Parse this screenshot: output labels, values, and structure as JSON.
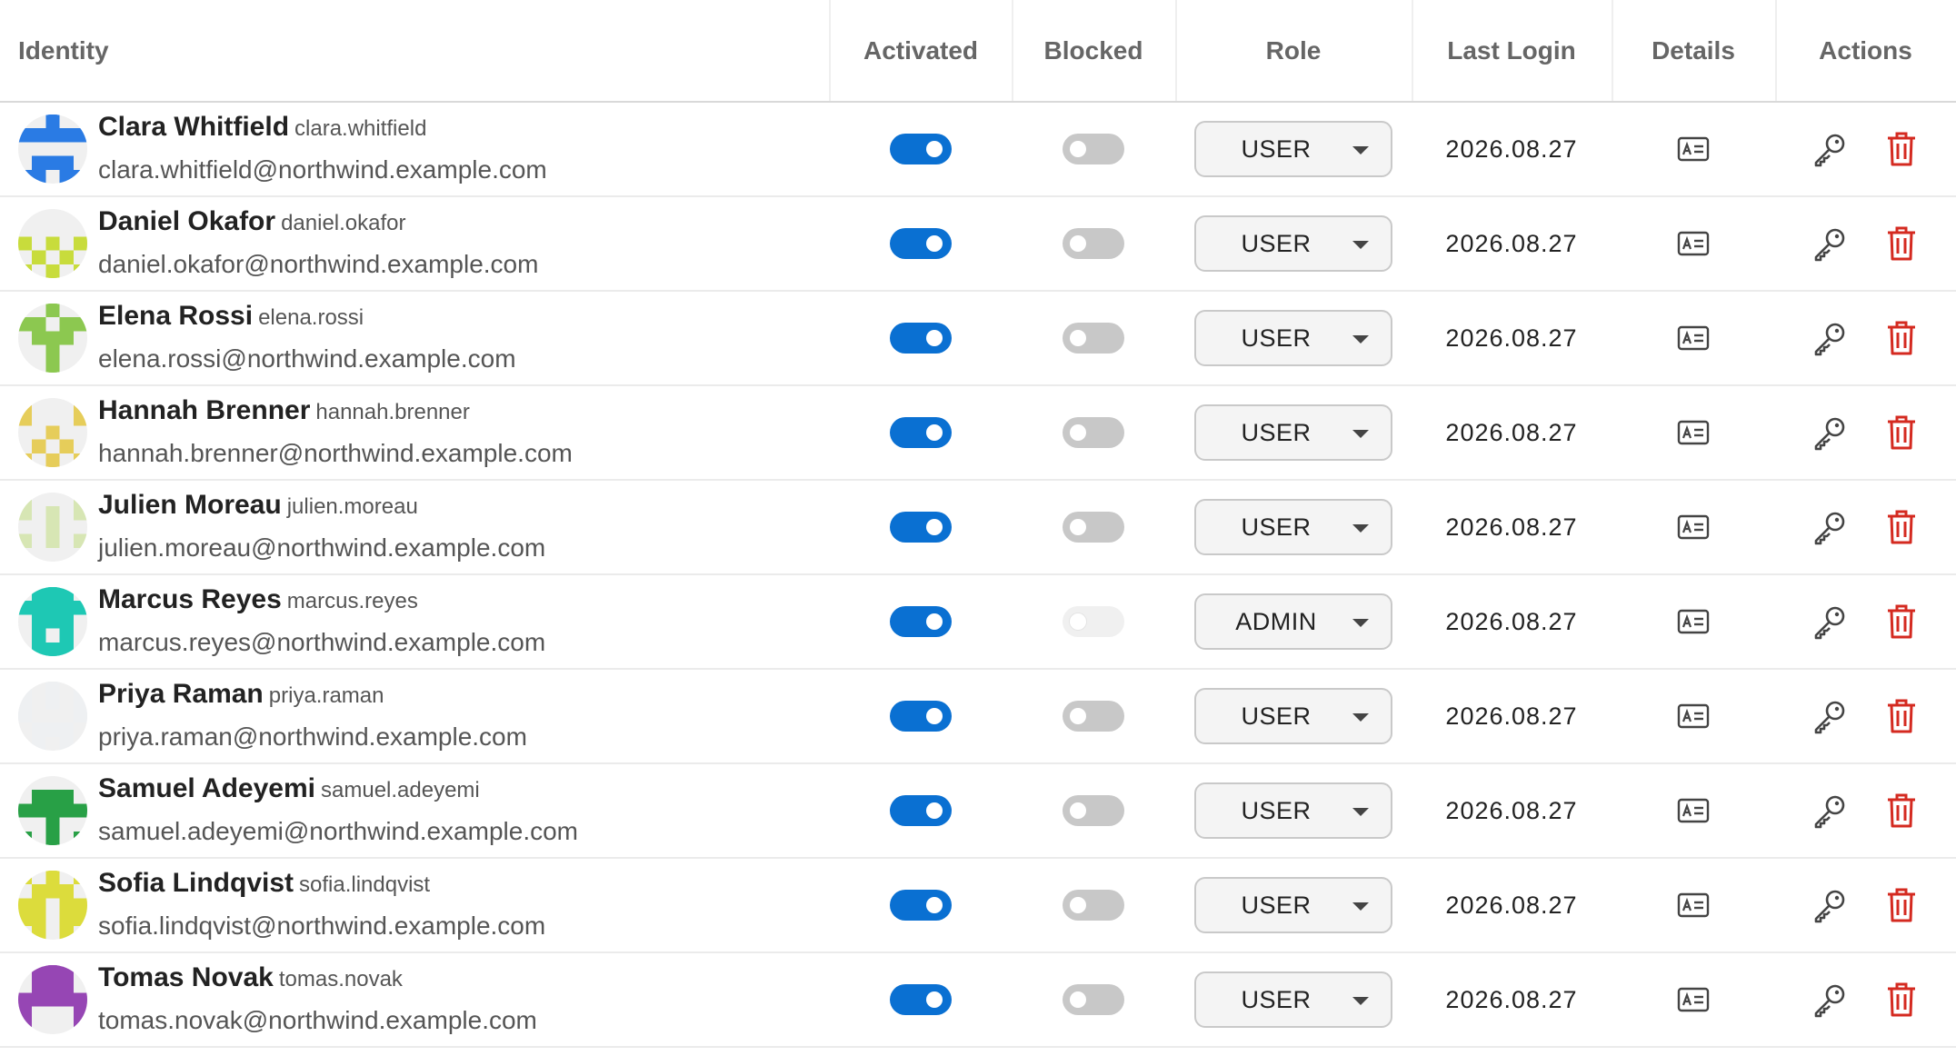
{
  "columns": {
    "identity": "Identity",
    "activated": "Activated",
    "blocked": "Blocked",
    "role": "Role",
    "last_login": "Last Login",
    "details": "Details",
    "actions": "Actions"
  },
  "colors": {
    "toggle_on": "#0a70d2",
    "toggle_off": "#c8c8c8",
    "delete": "#d42a20",
    "icon": "#444444"
  },
  "users": [
    {
      "name": "Clara Whitfield",
      "username": "clara.whitfield",
      "email": "clara.whitfield@northwind.example.com",
      "activated": true,
      "blocked": "off",
      "role": "USER",
      "last_login": "2026.08.27",
      "avatar_color": "#2a7be4"
    },
    {
      "name": "Daniel Okafor",
      "username": "daniel.okafor",
      "email": "daniel.okafor@northwind.example.com",
      "activated": true,
      "blocked": "off",
      "role": "USER",
      "last_login": "2026.08.27",
      "avatar_color": "#c8dc3c"
    },
    {
      "name": "Elena Rossi",
      "username": "elena.rossi",
      "email": "elena.rossi@northwind.example.com",
      "activated": true,
      "blocked": "off",
      "role": "USER",
      "last_login": "2026.08.27",
      "avatar_color": "#8cc850"
    },
    {
      "name": "Hannah Brenner",
      "username": "hannah.brenner",
      "email": "hannah.brenner@northwind.example.com",
      "activated": true,
      "blocked": "off",
      "role": "USER",
      "last_login": "2026.08.27",
      "avatar_color": "#e6cd5a"
    },
    {
      "name": "Julien Moreau",
      "username": "julien.moreau",
      "email": "julien.moreau@northwind.example.com",
      "activated": true,
      "blocked": "off",
      "role": "USER",
      "last_login": "2026.08.27",
      "avatar_color": "#d7e6b4"
    },
    {
      "name": "Marcus Reyes",
      "username": "marcus.reyes",
      "email": "marcus.reyes@northwind.example.com",
      "activated": true,
      "blocked": "disabled",
      "role": "ADMIN",
      "last_login": "2026.08.27",
      "avatar_color": "#1ec8b4"
    },
    {
      "name": "Priya Raman",
      "username": "priya.raman",
      "email": "priya.raman@northwind.example.com",
      "activated": true,
      "blocked": "off",
      "role": "USER",
      "last_login": "2026.08.27",
      "avatar_color": "#eef0f2"
    },
    {
      "name": "Samuel Adeyemi",
      "username": "samuel.adeyemi",
      "email": "samuel.adeyemi@northwind.example.com",
      "activated": true,
      "blocked": "off",
      "role": "USER",
      "last_login": "2026.08.27",
      "avatar_color": "#28a046"
    },
    {
      "name": "Sofia Lindqvist",
      "username": "sofia.lindqvist",
      "email": "sofia.lindqvist@northwind.example.com",
      "activated": true,
      "blocked": "off",
      "role": "USER",
      "last_login": "2026.08.27",
      "avatar_color": "#dcdc3c"
    },
    {
      "name": "Tomas Novak",
      "username": "tomas.novak",
      "email": "tomas.novak@northwind.example.com",
      "activated": true,
      "blocked": "off",
      "role": "USER",
      "last_login": "2026.08.27",
      "avatar_color": "#9646b4"
    }
  ],
  "icons": {
    "details": "id-card-icon",
    "reset_password": "key-icon",
    "delete": "trash-icon"
  }
}
